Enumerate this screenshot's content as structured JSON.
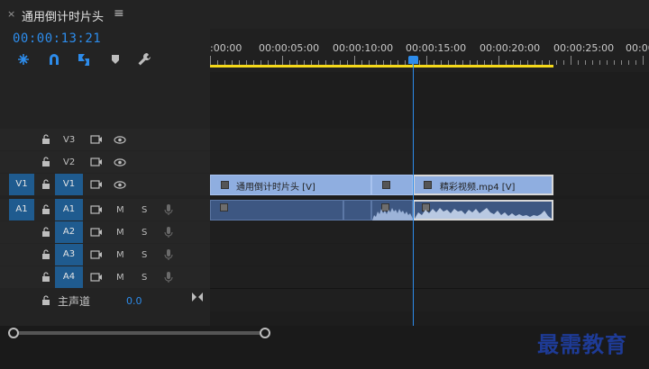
{
  "tab": {
    "title": "通用倒计时片头",
    "close_glyph": "×",
    "menu_glyph": "≡"
  },
  "timecode": "00:00:13:21",
  "ruler": {
    "labels": [
      ":00:00",
      "00:00:05:00",
      "00:00:10:00",
      "00:00:15:00",
      "00:00:20:00",
      "00:00:25:00",
      "00:00"
    ]
  },
  "tracks": {
    "video": [
      {
        "id": "V3",
        "source": ""
      },
      {
        "id": "V2",
        "source": ""
      },
      {
        "id": "V1",
        "source": "V1"
      }
    ],
    "audio": [
      {
        "id": "A1",
        "source": "A1"
      },
      {
        "id": "A2",
        "source": ""
      },
      {
        "id": "A3",
        "source": ""
      },
      {
        "id": "A4",
        "source": ""
      }
    ],
    "mute_label": "M",
    "solo_label": "S",
    "master_label": "主声道",
    "master_value": "0.0"
  },
  "clips": {
    "video1_name": "通用倒计时片头 [V]",
    "video2_name": "精彩视频.mp4 [V]"
  },
  "watermark": "最需教育",
  "colors": {
    "accent": "#2d8ceb",
    "work_area": "#f5d91a",
    "video_clip": "#8faee0",
    "audio_clip": "#3d5782"
  }
}
